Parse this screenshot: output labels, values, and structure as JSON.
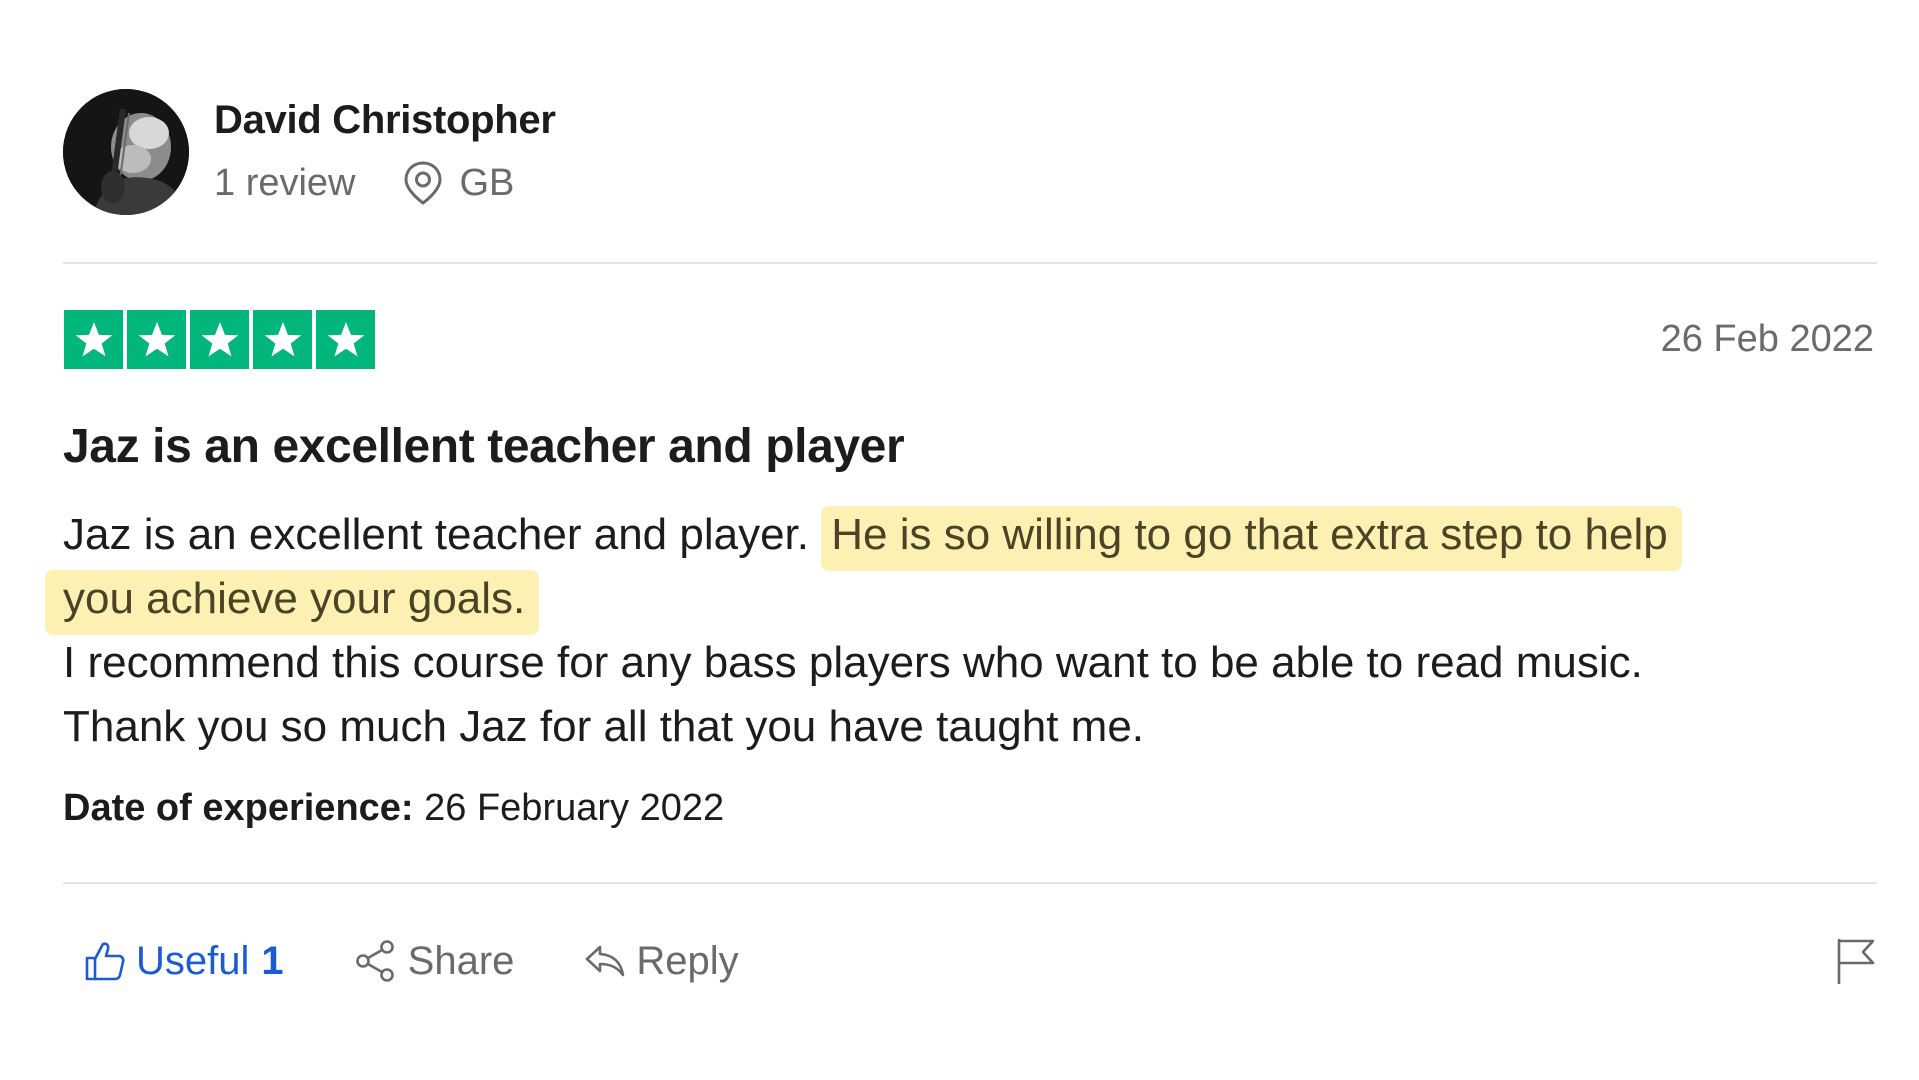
{
  "reviewer": {
    "name": "David Christopher",
    "review_count": "1 review",
    "location": "GB",
    "avatar_icon": "reviewer-photo"
  },
  "review": {
    "rating": 5,
    "rating_max": 5,
    "rating_color": "#00b67a",
    "date": "26 Feb 2022",
    "title": "Jaz is an excellent teacher and player",
    "body": {
      "line1_plain": "Jaz is an excellent teacher and player. ",
      "line1_highlight": "He is so willing to go that extra step to help",
      "line2_highlight": "you achieve your goals.",
      "line3": "I recommend this course for any bass players who want to be able to read music.",
      "line4": "Thank you so much Jaz for all that you have taught me."
    },
    "highlight_color": "#fdf0b3",
    "experience_label": "Date of experience:",
    "experience_date": " 26 February 2022"
  },
  "actions": {
    "useful_label": "Useful",
    "useful_count": "1",
    "share_label": "Share",
    "reply_label": "Reply",
    "useful_color": "#1c5bd6",
    "icons": [
      "thumbs-up-icon",
      "share-icon",
      "reply-icon",
      "flag-icon",
      "location-pin-icon"
    ]
  }
}
